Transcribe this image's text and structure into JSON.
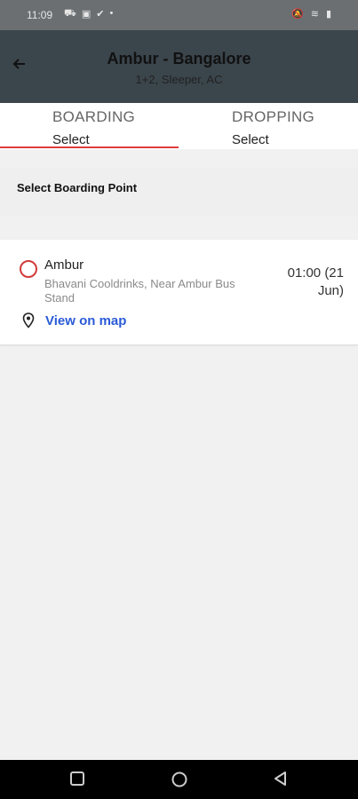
{
  "status_bar": {
    "time": "11:09",
    "notif_icons": [
      "car-icon",
      "teams-icon",
      "checkmark-icon",
      "dot-icon"
    ],
    "right_icons": [
      "silent-icon",
      "wifi-icon",
      "battery-icon"
    ]
  },
  "app_bar": {
    "title": "Ambur - Bangalore",
    "subtitle": "1+2, Sleeper, AC"
  },
  "tabs": [
    {
      "label": "BOARDING",
      "value": "Select",
      "active": true
    },
    {
      "label": "DROPPING",
      "value": "Select",
      "active": false
    }
  ],
  "section": {
    "heading": "Select Boarding Point"
  },
  "boarding_points": [
    {
      "name": "Ambur",
      "address": "Bhavani Cooldrinks, Near Ambur Bus Stand",
      "time": "01:00 (21 Jun)",
      "map_link": "View on map"
    }
  ],
  "colors": {
    "app_bar": "#3b454c",
    "accent": "#e03c3c",
    "link": "#2a5bd7"
  }
}
